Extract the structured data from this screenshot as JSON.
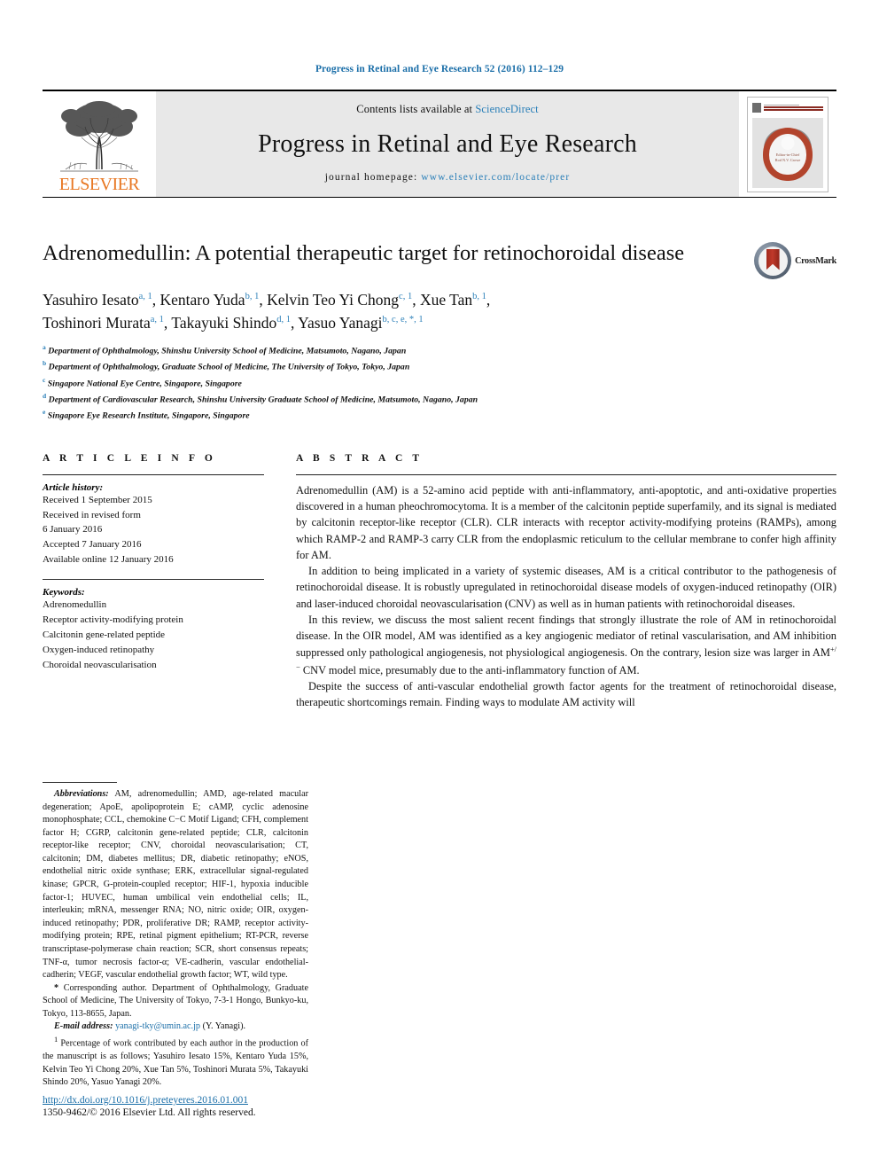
{
  "running_head": "Progress in Retinal and Eye Research 52 (2016) 112–129",
  "masthead": {
    "contents_prefix": "Contents lists available at ",
    "sciencedirect": "ScienceDirect",
    "journal_name": "Progress in Retinal and Eye Research",
    "homepage_prefix": "journal homepage: ",
    "homepage_url": "www.elsevier.com/locate/prer",
    "publisher": "ELSEVIER",
    "cover_title": "RETINAL AND EYE RESEARCH",
    "cover_editor": "Editor-in-Chief",
    "cover_editor_name": "Rod N.V. Crowe"
  },
  "article": {
    "title": "Adrenomedullin: A potential therapeutic target for retinochoroidal disease",
    "crossmark_label": "CrossMark",
    "authors_line1_parts": [
      {
        "name": "Yasuhiro Iesato",
        "sup": "a, 1"
      },
      {
        "name": "Kentaro Yuda",
        "sup": "b, 1"
      },
      {
        "name": "Kelvin Teo Yi Chong",
        "sup": "c, 1"
      },
      {
        "name": "Xue Tan",
        "sup": "b, 1"
      }
    ],
    "authors_line2_parts": [
      {
        "name": "Toshinori Murata",
        "sup": "a, 1"
      },
      {
        "name": "Takayuki Shindo",
        "sup": "d, 1"
      },
      {
        "name": "Yasuo Yanagi",
        "sup": "b, c, e, *, 1"
      }
    ],
    "affiliations": [
      {
        "mark": "a",
        "text": "Department of Ophthalmology, Shinshu University School of Medicine, Matsumoto, Nagano, Japan"
      },
      {
        "mark": "b",
        "text": "Department of Ophthalmology, Graduate School of Medicine, The University of Tokyo, Tokyo, Japan"
      },
      {
        "mark": "c",
        "text": "Singapore National Eye Centre, Singapore, Singapore"
      },
      {
        "mark": "d",
        "text": "Department of Cardiovascular Research, Shinshu University Graduate School of Medicine, Matsumoto, Nagano, Japan"
      },
      {
        "mark": "e",
        "text": "Singapore Eye Research Institute, Singapore, Singapore"
      }
    ]
  },
  "article_info": {
    "heading": "A R T I C L E   I N F O",
    "history_label": "Article history:",
    "history": [
      "Received 1 September 2015",
      "Received in revised form",
      "6 January 2016",
      "Accepted 7 January 2016",
      "Available online 12 January 2016"
    ],
    "keywords_label": "Keywords:",
    "keywords": [
      "Adrenomedullin",
      "Receptor activity-modifying protein",
      "Calcitonin gene-related peptide",
      "Oxygen-induced retinopathy",
      "Choroidal neovascularisation"
    ]
  },
  "abstract": {
    "heading": "A B S T R A C T",
    "paragraphs": [
      "Adrenomedullin (AM) is a 52-amino acid peptide with anti-inflammatory, anti-apoptotic, and anti-oxidative properties discovered in a human pheochromocytoma. It is a member of the calcitonin peptide superfamily, and its signal is mediated by calcitonin receptor-like receptor (CLR). CLR interacts with receptor activity-modifying proteins (RAMPs), among which RAMP-2 and RAMP-3 carry CLR from the endoplasmic reticulum to the cellular membrane to confer high affinity for AM.",
      "In addition to being implicated in a variety of systemic diseases, AM is a critical contributor to the pathogenesis of retinochoroidal disease. It is robustly upregulated in retinochoroidal disease models of oxygen-induced retinopathy (OIR) and laser-induced choroidal neovascularisation (CNV) as well as in human patients with retinochoroidal diseases.",
      "In this review, we discuss the most salient recent findings that strongly illustrate the role of AM in retinochoroidal disease. In the OIR model, AM was identified as a key angiogenic mediator of retinal vascularisation, and AM inhibition suppressed only pathological angiogenesis, not physiological angiogenesis. On the contrary, lesion size was larger in AM+/− CNV model mice, presumably due to the anti-inflammatory function of AM.",
      "Despite the success of anti-vascular endothelial growth factor agents for the treatment of retinochoroidal disease, therapeutic shortcomings remain. Finding ways to modulate AM activity will"
    ]
  },
  "footnotes": {
    "abbreviations_label": "Abbreviations:",
    "abbreviations_text": " AM, adrenomedullin; AMD, age-related macular degeneration; ApoE, apolipoprotein E; cAMP, cyclic adenosine monophosphate; CCL, chemokine C−C Motif Ligand; CFH, complement factor H; CGRP, calcitonin gene-related peptide; CLR, calcitonin receptor-like receptor; CNV, choroidal neovascularisation; CT, calcitonin; DM, diabetes mellitus; DR, diabetic retinopathy; eNOS, endothelial nitric oxide synthase; ERK, extracellular signal-regulated kinase; GPCR, G-protein-coupled receptor; HIF-1, hypoxia inducible factor-1; HUVEC, human umbilical vein endothelial cells; IL, interleukin; mRNA, messenger RNA; NO, nitric oxide; OIR, oxygen-induced retinopathy; PDR, proliferative DR; RAMP, receptor activity-modifying protein; RPE, retinal pigment epithelium; RT-PCR, reverse transcriptase-polymerase chain reaction; SCR, short consensus repeats; TNF-α, tumor necrosis factor-α; VE-cadherin, vascular endothelial-cadherin; VEGF, vascular endothelial growth factor; WT, wild type.",
    "corresponding_mark": "*",
    "corresponding_text": " Corresponding author. Department of Ophthalmology, Graduate School of Medicine, The University of Tokyo, 7-3-1 Hongo, Bunkyo-ku, Tokyo, 113-8655, Japan.",
    "email_label": "E-mail address:",
    "email": "yanagi-tky@umin.ac.jp",
    "email_suffix": " (Y. Yanagi).",
    "contribution_mark": "1",
    "contribution_text": " Percentage of work contributed by each author in the production of the manuscript is as follows; Yasuhiro Iesato 15%, Kentaro Yuda 15%, Kelvin Teo Yi Chong 20%, Xue Tan 5%, Toshinori Murata 5%, Takayuki Shindo 20%, Yasuo Yanagi 20%."
  },
  "footer": {
    "doi": "http://dx.doi.org/10.1016/j.preteyeres.2016.01.001",
    "issn_line": "1350-9462/© 2016 Elsevier Ltd. All rights reserved."
  },
  "colors": {
    "link": "#1a6ea8",
    "elsevier_orange": "#E87722",
    "masthead_gray": "#e8e8e8"
  }
}
